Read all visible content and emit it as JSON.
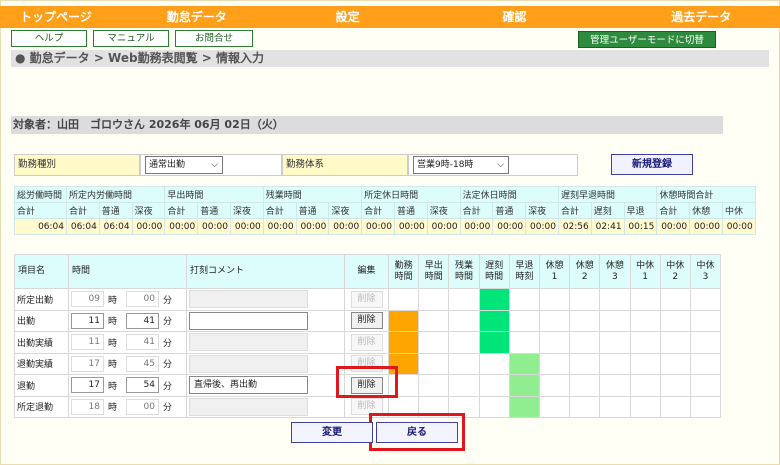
{
  "nav": [
    "トップページ",
    "勤怠データ",
    "設定",
    "確認",
    "過去データ"
  ],
  "buttons": {
    "help": "ヘルプ",
    "manual": "マニュアル",
    "contact": "お問合せ",
    "manager_mode": "管理ユーザーモードに切替"
  },
  "breadcrumb": "● 勤怠データ > Web勤務表閲覧 > 情報入力",
  "target": "対象者：山田　ゴロウさん 2026年 06月 02日（火）",
  "type_row": {
    "kind_label": "勤務種別",
    "kind_value": "通常出勤",
    "system_label": "勤務体系",
    "system_value": "営業9時-18時",
    "new_button": "新規登録"
  },
  "summary": {
    "groups": [
      "総労働時間",
      "所定内労働時間",
      "早出時間",
      "残業時間",
      "所定休日時間",
      "法定休日時間",
      "遅刻早退時間",
      "休憩時間合計"
    ],
    "subs": [
      "合計",
      "合計",
      "普通",
      "深夜",
      "合計",
      "普通",
      "深夜",
      "合計",
      "普通",
      "深夜",
      "合計",
      "普通",
      "深夜",
      "合計",
      "普通",
      "深夜",
      "合計",
      "遅刻",
      "早退",
      "合計",
      "休憩",
      "中休"
    ],
    "values": [
      "06:04",
      "06:04",
      "06:04",
      "00:00",
      "00:00",
      "00:00",
      "00:00",
      "00:00",
      "00:00",
      "00:00",
      "00:00",
      "00:00",
      "00:00",
      "00:00",
      "00:00",
      "00:00",
      "02:56",
      "02:41",
      "00:15",
      "00:00",
      "00:00",
      "00:00"
    ]
  },
  "main": {
    "headers": {
      "item": "項目名",
      "time": "時間",
      "comment": "打刻コメント",
      "edit": "編集",
      "cols": [
        [
          "勤務",
          "時間"
        ],
        [
          "早出",
          "時間"
        ],
        [
          "残業",
          "時間"
        ],
        [
          "遅刻",
          "時間"
        ],
        [
          "早退",
          "時刻"
        ],
        [
          "休憩",
          "1"
        ],
        [
          "休憩",
          "2"
        ],
        [
          "休憩",
          "3"
        ],
        [
          "中休",
          "1"
        ],
        [
          "中休",
          "2"
        ],
        [
          "中休",
          "3"
        ]
      ]
    },
    "hour_unit": "時",
    "min_unit": "分",
    "delete_label": "削除",
    "rows": [
      {
        "name": "所定出勤",
        "h": "09",
        "m": "00",
        "comment": ""
      },
      {
        "name": "出勤",
        "h": "11",
        "m": "41",
        "comment": ""
      },
      {
        "name": "出勤実績",
        "h": "11",
        "m": "41",
        "comment": ""
      },
      {
        "name": "退勤実績",
        "h": "17",
        "m": "45",
        "comment": ""
      },
      {
        "name": "退勤",
        "h": "17",
        "m": "54",
        "comment": "直帰後、再出勤"
      },
      {
        "name": "所定退勤",
        "h": "18",
        "m": "00",
        "comment": ""
      }
    ]
  },
  "bottom": {
    "change": "変更",
    "back": "戻る"
  },
  "colors": {
    "nav": "#ff9f1a",
    "work": "#ffa500",
    "late": "#00e57a",
    "early": "#90ee90",
    "highlight": "#e0171e"
  }
}
